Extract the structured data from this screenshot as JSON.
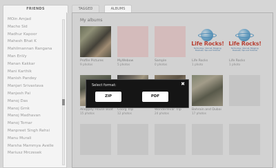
{
  "friends": {
    "tab_label": "FRIENDS",
    "items": [
      "MOin Amjad",
      "Macho Sid",
      "Madhur Kapoor",
      "Mahesh Bhat K",
      "Mahilmannan Rangana",
      "Man EnVy",
      "Manan Kakkar",
      "Mani Karthik",
      "Manish Pandey",
      "Manjari Srivastava",
      "Manjesh Pai",
      "Manoj Das",
      "Manoj Grnk",
      "Manoj Madhavan",
      "Manoj Tomar",
      "Manpreet Singh Rehsi",
      "Manu Murali",
      "Marsha Mammya Avelle",
      "Mariusz Mrczesek"
    ]
  },
  "tabs": {
    "tagged": "TAGGED",
    "albums": "ALBUMS"
  },
  "section_title": "My albums",
  "albums_row1": [
    {
      "title": "Profile Pictures",
      "count": "9 photos"
    },
    {
      "title": "MyWebow",
      "count": "5 photos"
    },
    {
      "title": "Sample",
      "count": "0 photos"
    },
    {
      "title": "Life Rocks",
      "count": "1 photo"
    },
    {
      "title": "Life Rocks",
      "count": "1 photo"
    }
  ],
  "albums_row2": [
    {
      "title": "Alleppey House Boat",
      "count": "15 photos"
    },
    {
      "title": "Coorg Trip",
      "count": "12 photos"
    },
    {
      "title": "Wonderlevar Trip",
      "count": "24 photos"
    },
    {
      "title": "Bahrain and Dubai",
      "count": "17 photos"
    }
  ],
  "logo": {
    "title": "Life Rocks!",
    "tagline": "Technology, Internet, Blogging, Business, Tips and Tutorials"
  },
  "dialog": {
    "label": "Select format:",
    "close": "✖",
    "zip": "ZIP",
    "pdf": "PDF"
  },
  "colors": {
    "dialog_bg": "#151515",
    "logo_red": "#d23a2a",
    "placeholder_pink": "#f7d7d7"
  }
}
